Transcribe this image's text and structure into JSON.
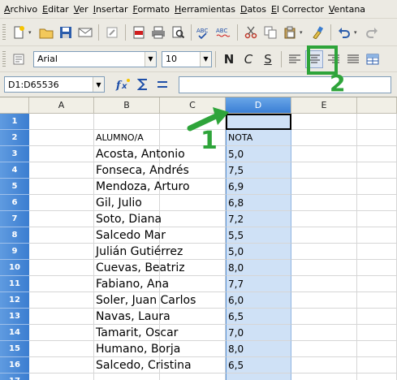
{
  "menubar": {
    "items": [
      "Archivo",
      "Editar",
      "Ver",
      "Insertar",
      "Formato",
      "Herramientas",
      "Datos",
      "El Corrector",
      "Ventana"
    ]
  },
  "format_toolbar": {
    "font_name": "Arial",
    "font_size": "10",
    "bold_label": "N",
    "italic_label": "C",
    "underline_label": "S"
  },
  "formula_bar": {
    "name_box": "D1:D65536",
    "input_value": ""
  },
  "grid": {
    "columns": [
      "A",
      "B",
      "C",
      "D",
      "E"
    ],
    "selected_column": "D",
    "rows": [
      {
        "n": "1",
        "b": "",
        "d": ""
      },
      {
        "n": "2",
        "b": "ALUMNO/A",
        "d": "NOTA"
      },
      {
        "n": "3",
        "b": "Acosta, Antonio",
        "d": "5,0"
      },
      {
        "n": "4",
        "b": "Fonseca, Andrés",
        "d": "7,5"
      },
      {
        "n": "5",
        "b": "Mendoza, Arturo",
        "d": "6,9"
      },
      {
        "n": "6",
        "b": "Gil, Julio",
        "d": "6,8"
      },
      {
        "n": "7",
        "b": "Soto, Diana",
        "d": "7,2"
      },
      {
        "n": "8",
        "b": "Salcedo Mar",
        "d": "5,5"
      },
      {
        "n": "9",
        "b": "Julián Gutiérrez",
        "d": "5,0"
      },
      {
        "n": "10",
        "b": "Cuevas, Beatriz",
        "d": "8,0"
      },
      {
        "n": "11",
        "b": "Fabiano, Ana",
        "d": "7,7"
      },
      {
        "n": "12",
        "b": "Soler, Juan Carlos",
        "d": "6,0"
      },
      {
        "n": "13",
        "b": "Navas, Laura",
        "d": "6,5"
      },
      {
        "n": "14",
        "b": "Tamarit, Oscar",
        "d": "7,0"
      },
      {
        "n": "15",
        "b": "Humano, Borja",
        "d": "8,0"
      },
      {
        "n": "16",
        "b": "Salcedo, Cristina",
        "d": "6,5"
      },
      {
        "n": "17",
        "b": "",
        "d": ""
      }
    ]
  },
  "annotations": {
    "step1": "1",
    "step2": "2",
    "color": "#2ea43a"
  }
}
